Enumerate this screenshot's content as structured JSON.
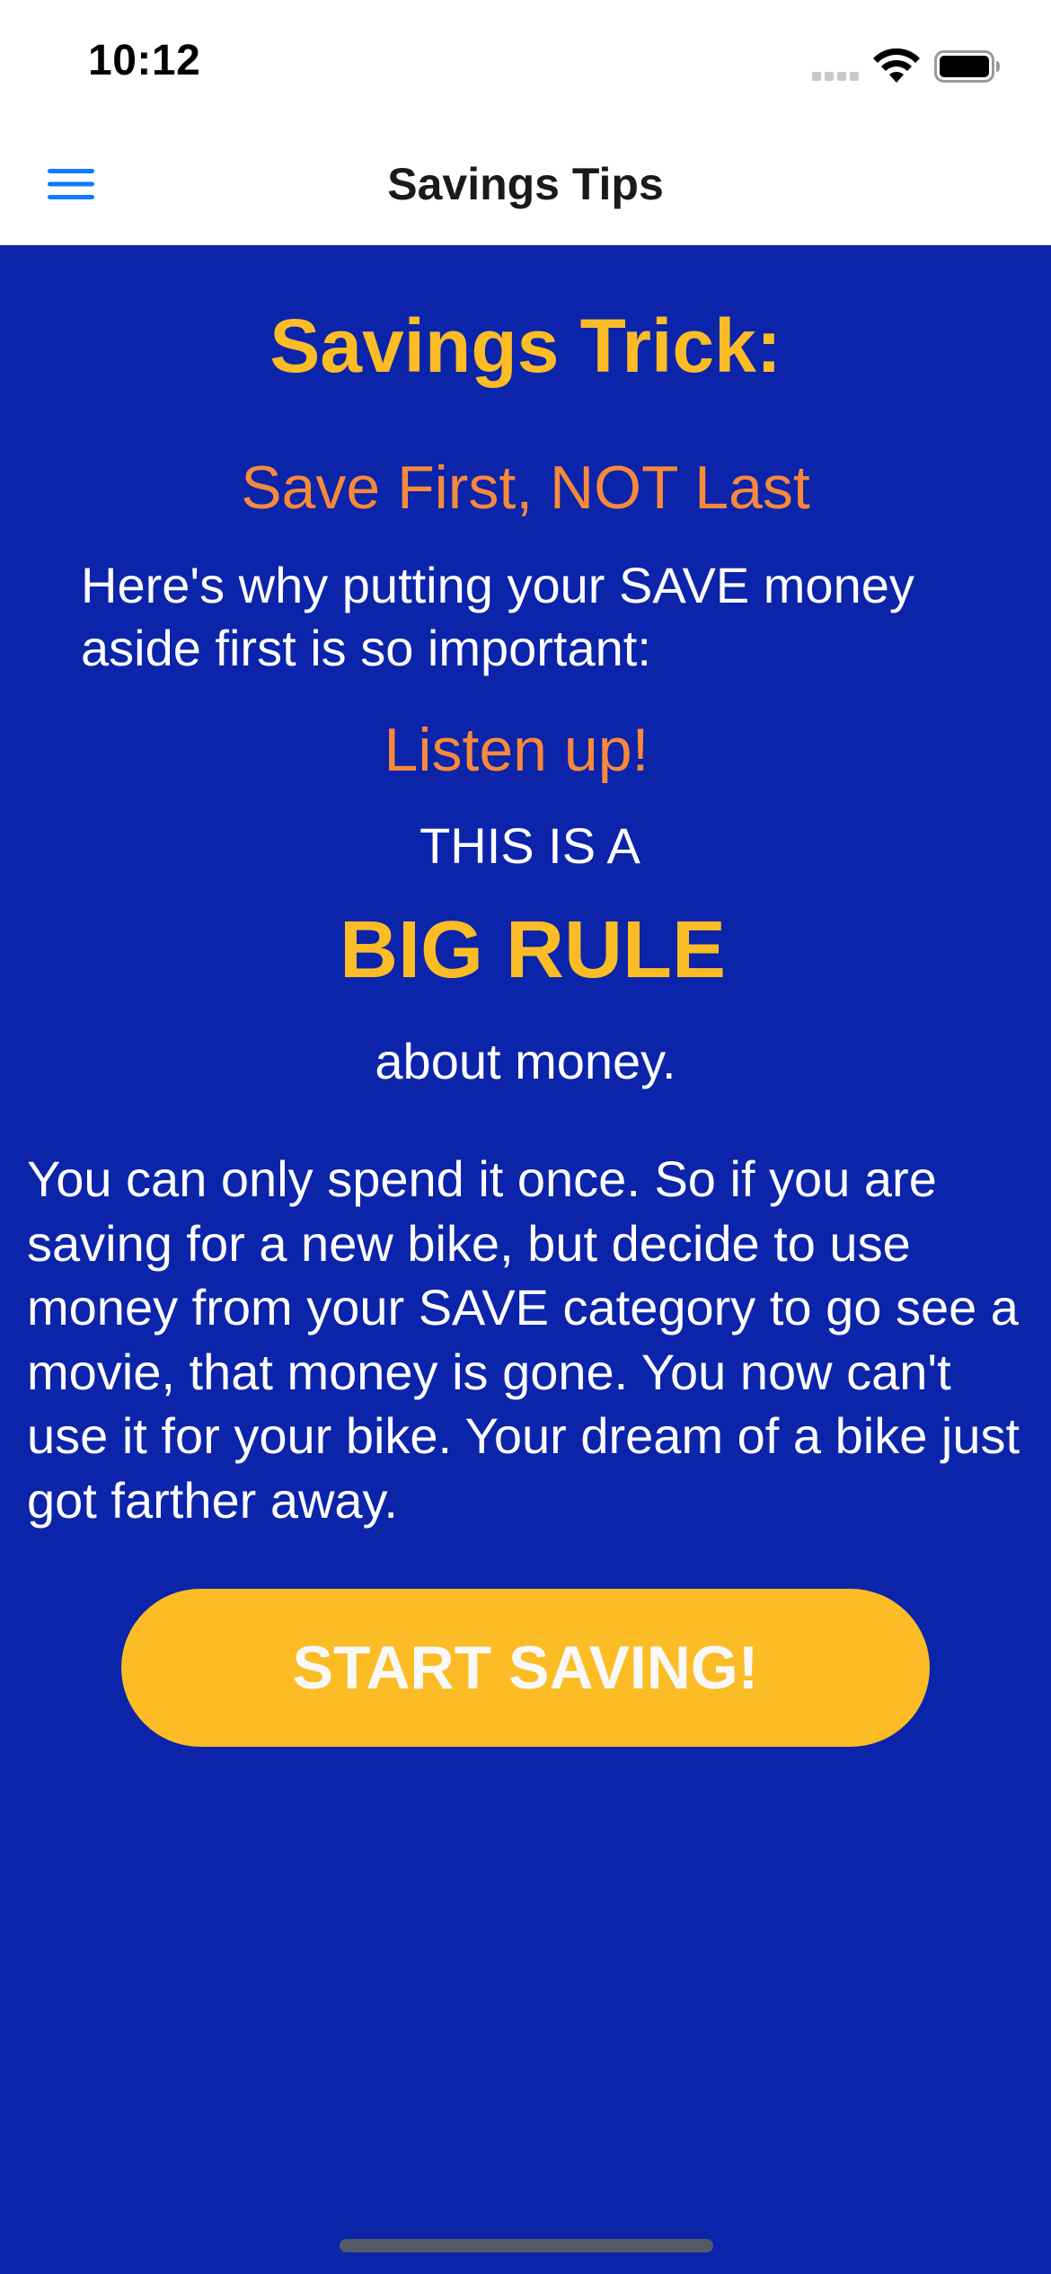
{
  "status_bar": {
    "time": "10:12",
    "icons": [
      "cell-signal-icon",
      "wifi-icon",
      "battery-icon"
    ]
  },
  "nav": {
    "title": "Savings Tips",
    "menu_icon": "hamburger-menu-icon"
  },
  "content": {
    "heading": "Savings Trick:",
    "subheading": "Save First, NOT Last",
    "intro": "Here's why putting your SAVE money aside first is so important:",
    "listen": "Listen up!",
    "this_is_a": "THIS IS A",
    "big_rule": "BIG RULE",
    "about_money": "about money.",
    "body": "You can only spend it once. So if you are saving for a new bike, but decide to use money from your SAVE category to go see a movie, that money is gone. You now can't use it for your bike. Your dream of a bike just got farther away.",
    "button_label": "START SAVING!"
  },
  "colors": {
    "background": "#0b24aa",
    "accent_yellow": "#fbbc25",
    "accent_orange": "#f7893a",
    "menu_blue": "#0a7bff",
    "text_white": "#ffffff"
  }
}
